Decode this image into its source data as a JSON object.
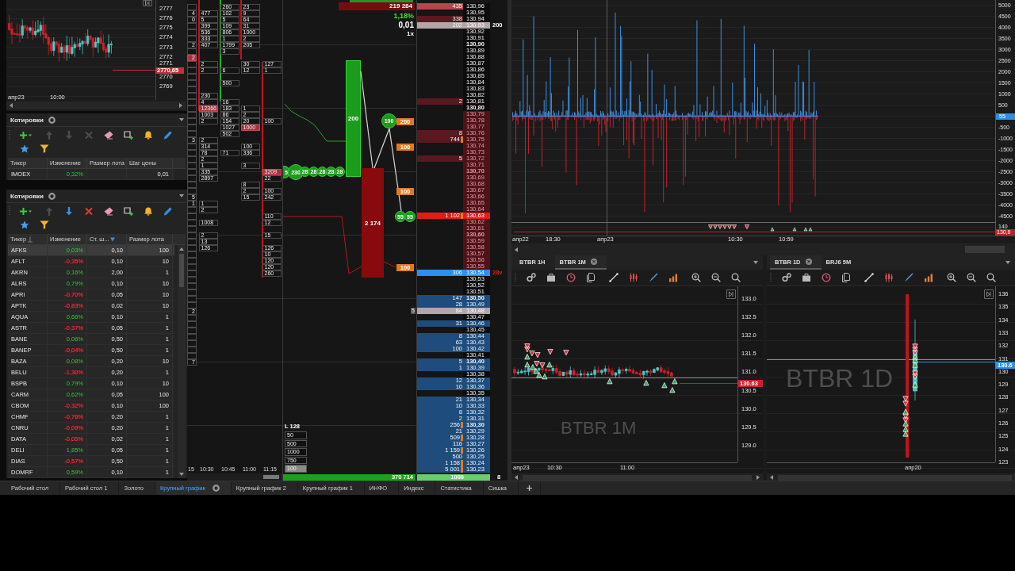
{
  "top_left_chart": {
    "price_labels": [
      "2777",
      "2776",
      "2775",
      "2774",
      "2773",
      "2772",
      "2771",
      "2770",
      "2769"
    ],
    "current_price": "2770,65",
    "time_labels": [
      "апр23",
      "10:00"
    ]
  },
  "quotes_panels": [
    {
      "title": "Котировки",
      "tools": [
        {
          "kind": "add",
          "disabled": false
        },
        {
          "kind": "up",
          "disabled": true
        },
        {
          "kind": "down",
          "disabled": true
        },
        {
          "kind": "delete",
          "disabled": true
        },
        {
          "kind": "eraser",
          "disabled": false
        },
        {
          "kind": "window",
          "disabled": false
        },
        {
          "kind": "bell",
          "disabled": false
        },
        {
          "kind": "pencil",
          "disabled": false
        },
        {
          "kind": "star",
          "disabled": false
        },
        {
          "kind": "filter",
          "disabled": false
        }
      ],
      "columns": [
        {
          "label": "Тикер",
          "kind": "ticker"
        },
        {
          "label": "Изменение",
          "kind": "change"
        },
        {
          "label": "Размер лота",
          "kind": "number"
        },
        {
          "label": "Шаг цены",
          "kind": "number"
        }
      ],
      "rows": [
        {
          "cells": [
            "IMOEX",
            "0,32%",
            null,
            "0,01"
          ],
          "negative": false,
          "selected": false
        }
      ]
    },
    {
      "title": "Котировки",
      "tools": [
        {
          "kind": "add",
          "disabled": false
        },
        {
          "kind": "up",
          "disabled": true
        },
        {
          "kind": "down",
          "disabled": false
        },
        {
          "kind": "delete",
          "disabled": false
        },
        {
          "kind": "eraser",
          "disabled": false
        },
        {
          "kind": "window",
          "disabled": false
        },
        {
          "kind": "bell",
          "disabled": false
        },
        {
          "kind": "pencil",
          "disabled": false
        },
        {
          "kind": "star",
          "disabled": false
        },
        {
          "kind": "filter",
          "disabled": false
        }
      ],
      "columns": [
        {
          "label": "Тикер",
          "kind": "ticker",
          "sorted": true,
          "filtered": false
        },
        {
          "label": "Изменение",
          "kind": "change",
          "sorted": false,
          "filtered": false
        },
        {
          "label": "Ст. ш...",
          "kind": "number",
          "sorted": false,
          "filtered": true
        },
        {
          "label": "Размер лота",
          "kind": "number",
          "sorted": false,
          "filtered": false
        }
      ],
      "rows": [
        {
          "cells": [
            "AFKS",
            "0,03%",
            "0,10",
            "100"
          ],
          "negative": false,
          "selected": true
        },
        {
          "cells": [
            "AFLT",
            "-0,35%",
            "0,10",
            "10"
          ],
          "negative": true,
          "selected": false
        },
        {
          "cells": [
            "AKRN",
            "0,16%",
            "2,00",
            "1"
          ],
          "negative": false,
          "selected": false
        },
        {
          "cells": [
            "ALRS",
            "0,79%",
            "0,10",
            "10"
          ],
          "negative": false,
          "selected": false
        },
        {
          "cells": [
            "APRI",
            "-0,70%",
            "0,05",
            "10"
          ],
          "negative": true,
          "selected": false
        },
        {
          "cells": [
            "APTK",
            "-0,83%",
            "0,02",
            "10"
          ],
          "negative": true,
          "selected": false
        },
        {
          "cells": [
            "AQUA",
            "0,66%",
            "0,10",
            "1"
          ],
          "negative": false,
          "selected": false
        },
        {
          "cells": [
            "ASTR",
            "-0,37%",
            "0,05",
            "1"
          ],
          "negative": true,
          "selected": false
        },
        {
          "cells": [
            "BANE",
            "0,06%",
            "0,50",
            "1"
          ],
          "negative": false,
          "selected": false
        },
        {
          "cells": [
            "BANEP",
            "-0,04%",
            "0,50",
            "1"
          ],
          "negative": true,
          "selected": false
        },
        {
          "cells": [
            "BAZA",
            "0,08%",
            "0,20",
            "10"
          ],
          "negative": false,
          "selected": false
        },
        {
          "cells": [
            "BELU",
            "-1,30%",
            "0,20",
            "1"
          ],
          "negative": true,
          "selected": false
        },
        {
          "cells": [
            "BSPB",
            "0,79%",
            "0,10",
            "10"
          ],
          "negative": false,
          "selected": false
        },
        {
          "cells": [
            "CARM",
            "0,62%",
            "0,05",
            "100"
          ],
          "negative": false,
          "selected": false
        },
        {
          "cells": [
            "CBOM",
            "-0,32%",
            "0,10",
            "100"
          ],
          "negative": true,
          "selected": false
        },
        {
          "cells": [
            "CHMF",
            "-0,76%",
            "0,20",
            "1"
          ],
          "negative": true,
          "selected": false
        },
        {
          "cells": [
            "CNRU",
            "-0,09%",
            "0,20",
            "1"
          ],
          "negative": true,
          "selected": false
        },
        {
          "cells": [
            "DATA",
            "-0,05%",
            "0,02",
            "1"
          ],
          "negative": true,
          "selected": false
        },
        {
          "cells": [
            "DELI",
            "1,85%",
            "0,05",
            "1"
          ],
          "negative": false,
          "selected": false
        },
        {
          "cells": [
            "DIAS",
            "-0,57%",
            "0,50",
            "1"
          ],
          "negative": true,
          "selected": false
        },
        {
          "cells": [
            "DOMRF",
            "0,59%",
            "0,10",
            "1"
          ],
          "negative": false,
          "selected": false
        }
      ]
    }
  ],
  "cluster": {
    "rows": [
      {
        "cells": [
          null,
          null,
          {
            "text": "260",
            "hot": false
          },
          {
            "text": "23",
            "hot": false
          },
          null
        ]
      },
      {
        "cells": [
          {
            "text": "4",
            "hot": false
          },
          {
            "text": "477",
            "hot": false
          },
          {
            "text": "102",
            "hot": false
          },
          {
            "text": "9",
            "hot": false
          },
          null
        ]
      },
      {
        "cells": [
          {
            "text": "0",
            "hot": false
          },
          {
            "text": "5",
            "hot": false
          },
          {
            "text": "5",
            "hot": false
          },
          {
            "text": "64",
            "hot": false
          },
          null
        ]
      },
      {
        "cells": [
          null,
          {
            "text": "399",
            "hot": false
          },
          {
            "text": "109",
            "hot": false
          },
          {
            "text": "31",
            "hot": false
          },
          null
        ]
      },
      {
        "cells": [
          null,
          {
            "text": "536",
            "hot": false
          },
          {
            "text": "806",
            "hot": false
          },
          {
            "text": "1000",
            "hot": false
          },
          null
        ]
      },
      {
        "cells": [
          null,
          {
            "text": "333",
            "hot": false
          },
          {
            "text": "1",
            "hot": false
          },
          {
            "text": "2",
            "hot": false
          },
          null
        ]
      },
      {
        "cells": [
          {
            "text": "2",
            "hot": false
          },
          {
            "text": "407",
            "hot": false
          },
          {
            "text": "1799",
            "hot": false
          },
          {
            "text": "205",
            "hot": false
          },
          null
        ]
      },
      {
        "cells": [
          null,
          null,
          {
            "text": "3",
            "hot": false
          },
          null,
          null
        ]
      },
      {
        "cells": [
          {
            "text": "2",
            "hot": true
          },
          null,
          null,
          null,
          null
        ]
      },
      {
        "cells": [
          null,
          {
            "text": "2",
            "hot": false
          },
          null,
          {
            "text": "30",
            "hot": false
          },
          {
            "text": "127",
            "hot": false
          }
        ]
      },
      {
        "cells": [
          null,
          {
            "text": "2",
            "hot": false
          },
          {
            "text": "6",
            "hot": false
          },
          {
            "text": "12",
            "hot": false
          },
          {
            "text": "1",
            "hot": false
          }
        ]
      },
      {
        "cells": [
          null,
          null,
          null,
          null,
          null
        ]
      },
      {
        "cells": [
          null,
          null,
          {
            "text": "500",
            "hot": false
          },
          null,
          null
        ]
      },
      {
        "cells": [
          null,
          null,
          null,
          null,
          null
        ]
      },
      {
        "cells": [
          null,
          {
            "text": "230",
            "hot": false
          },
          null,
          null,
          null
        ]
      },
      {
        "cells": [
          null,
          {
            "text": "4",
            "hot": false
          },
          {
            "text": "16",
            "hot": false
          },
          null,
          null
        ]
      },
      {
        "cells": [
          null,
          {
            "text": "12366",
            "hot": true
          },
          {
            "text": "183",
            "hot": false
          },
          {
            "text": "1",
            "hot": false
          },
          null
        ]
      },
      {
        "cells": [
          null,
          {
            "text": "1003",
            "hot": false
          },
          {
            "text": "86",
            "hot": false
          },
          {
            "text": "2",
            "hot": false
          },
          null
        ]
      },
      {
        "cells": [
          null,
          {
            "text": "2",
            "hot": false
          },
          {
            "text": "154",
            "hot": false
          },
          {
            "text": "20",
            "hot": false
          },
          {
            "text": "100",
            "hot": false
          }
        ]
      },
      {
        "cells": [
          null,
          null,
          {
            "text": "1027",
            "hot": false
          },
          {
            "text": "1000",
            "hot": true
          },
          null
        ]
      },
      {
        "cells": [
          null,
          null,
          {
            "text": "502",
            "hot": false
          },
          null,
          null
        ]
      },
      {
        "cells": [
          {
            "text": "3",
            "hot": false
          },
          {
            "text": "2",
            "hot": false
          },
          null,
          null,
          null
        ]
      },
      {
        "cells": [
          null,
          {
            "text": "314",
            "hot": false
          },
          null,
          {
            "text": "100",
            "hot": false
          },
          null
        ]
      },
      {
        "cells": [
          null,
          {
            "text": "78",
            "hot": false
          },
          {
            "text": "71",
            "hot": false
          },
          {
            "text": "336",
            "hot": false
          },
          null
        ]
      },
      {
        "cells": [
          null,
          {
            "text": "2",
            "hot": false
          },
          null,
          null,
          null
        ]
      },
      {
        "cells": [
          null,
          {
            "text": "1",
            "hot": false
          },
          null,
          {
            "text": "3",
            "hot": false
          },
          null
        ]
      },
      {
        "cells": [
          null,
          {
            "text": "335",
            "hot": false
          },
          null,
          null,
          {
            "text": "3209",
            "hot": true
          }
        ]
      },
      {
        "cells": [
          null,
          {
            "text": "2897",
            "hot": false
          },
          null,
          null,
          {
            "text": "22",
            "hot": false
          }
        ]
      },
      {
        "cells": [
          null,
          null,
          null,
          {
            "text": "8",
            "hot": false
          },
          null
        ]
      },
      {
        "cells": [
          null,
          null,
          null,
          {
            "text": "2",
            "hot": false
          },
          {
            "text": "100",
            "hot": false
          }
        ]
      },
      {
        "cells": [
          {
            "text": "5",
            "hot": false
          },
          null,
          null,
          {
            "text": "15",
            "hot": false
          },
          {
            "text": "242",
            "hot": false
          }
        ]
      },
      {
        "cells": [
          {
            "text": "1",
            "hot": false
          },
          {
            "text": "1",
            "hot": false
          },
          null,
          null,
          null
        ]
      },
      {
        "cells": [
          null,
          {
            "text": "2",
            "hot": false
          },
          null,
          null,
          null
        ]
      },
      {
        "cells": [
          null,
          null,
          null,
          null,
          {
            "text": "110",
            "hot": false
          }
        ]
      },
      {
        "cells": [
          null,
          {
            "text": "1008",
            "hot": false
          },
          null,
          null,
          {
            "text": "12",
            "hot": false
          }
        ]
      },
      {
        "cells": [
          null,
          null,
          null,
          null,
          null
        ]
      },
      {
        "cells": [
          null,
          {
            "text": "2",
            "hot": false
          },
          null,
          null,
          {
            "text": "15",
            "hot": false
          }
        ]
      },
      {
        "cells": [
          null,
          {
            "text": "13",
            "hot": false
          },
          null,
          null,
          null
        ]
      },
      {
        "cells": [
          null,
          {
            "text": "126",
            "hot": false
          },
          null,
          null,
          {
            "text": "126",
            "hot": false
          }
        ]
      },
      {
        "cells": [
          null,
          null,
          null,
          null,
          {
            "text": "10",
            "hot": false
          }
        ]
      },
      {
        "cells": [
          null,
          null,
          null,
          null,
          {
            "text": "120",
            "hot": false
          }
        ]
      },
      {
        "cells": [
          null,
          null,
          null,
          null,
          {
            "text": "120",
            "hot": false
          }
        ]
      },
      {
        "cells": [
          null,
          null,
          null,
          null,
          {
            "text": "260",
            "hot": false
          }
        ]
      },
      {
        "cells": [
          null,
          null,
          null,
          null,
          null
        ]
      },
      {
        "cells": [
          null,
          null,
          null,
          null,
          null
        ]
      },
      {
        "cells": [
          null,
          null,
          null,
          null,
          null
        ]
      },
      {
        "cells": [
          null,
          null,
          null,
          null,
          null
        ]
      },
      {
        "cells": [
          null,
          null,
          null,
          null,
          null
        ]
      },
      {
        "cells": [
          {
            "text": "2",
            "hot": false
          },
          null,
          null,
          null,
          null
        ]
      },
      {
        "cells": [
          null,
          null,
          null,
          null,
          null
        ]
      },
      {
        "cells": [
          null,
          null,
          null,
          null,
          null
        ]
      },
      {
        "cells": [
          null,
          null,
          null,
          null,
          null
        ]
      },
      {
        "cells": [
          null,
          null,
          null,
          null,
          null
        ]
      },
      {
        "cells": [
          null,
          null,
          null,
          null,
          null
        ]
      },
      {
        "cells": [
          null,
          null,
          null,
          null,
          null
        ]
      },
      {
        "cells": [
          null,
          null,
          null,
          null,
          null
        ]
      },
      {
        "cells": [
          {
            "text": "7",
            "hot": false
          },
          null,
          null,
          null,
          null
        ]
      }
    ],
    "time_labels": [
      "15",
      "10:30",
      "10:45",
      "11:00",
      "11:15"
    ]
  },
  "footprint": {
    "header_volume": "219 284",
    "change": "1,18%",
    "price_step": "0,01",
    "scale": "1x",
    "bars": [
      {
        "kind": "buy",
        "label": "200"
      },
      {
        "kind": "sell",
        "label": "2 174"
      }
    ],
    "bubbles": [
      {
        "label": "5"
      },
      {
        "label": "230"
      },
      {
        "label": "28"
      },
      {
        "label": "28"
      },
      {
        "label": "28"
      },
      {
        "label": "28"
      },
      {
        "label": "28"
      },
      {
        "label": "100"
      },
      {
        "label": "55"
      },
      {
        "label": "55"
      }
    ],
    "orders": [
      {
        "label": "200"
      },
      {
        "label": "100"
      },
      {
        "label": "100"
      },
      {
        "label": "100"
      }
    ],
    "lot_title": "L 128",
    "lot_presets": [
      {
        "label": "50",
        "selected": false
      },
      {
        "label": "500",
        "selected": false
      },
      {
        "label": "1000",
        "selected": false
      },
      {
        "label": "750",
        "selected": false
      },
      {
        "label": "100",
        "selected": true
      }
    ],
    "total_volume": "370 714"
  },
  "order_book": {
    "rows": [
      {
        "price": "130,96",
        "volume": "435",
        "kind": "ask_strong",
        "bold": false,
        "order": false
      },
      {
        "price": "130,95",
        "kind": "plain",
        "bold": false,
        "order": false
      },
      {
        "price": "130,94",
        "volume": "338",
        "kind": "ask",
        "bold": false,
        "order": false
      },
      {
        "price": "130,93",
        "volume": "202",
        "kind": "cursor",
        "bold": false,
        "order": false,
        "note": {
          "text": "200",
          "color": "#ffffff"
        }
      },
      {
        "price": "130,92",
        "kind": "plain",
        "bold": false,
        "order": false
      },
      {
        "price": "130,91",
        "kind": "plain",
        "bold": false,
        "order": false
      },
      {
        "price": "130,90",
        "kind": "plain",
        "bold": true,
        "order": false
      },
      {
        "price": "130,89",
        "kind": "plain",
        "bold": false,
        "order": false
      },
      {
        "price": "130,88",
        "kind": "plain",
        "bold": false,
        "order": false
      },
      {
        "price": "130,87",
        "kind": "plain",
        "bold": false,
        "order": false
      },
      {
        "price": "130,86",
        "kind": "plain",
        "bold": false,
        "order": false
      },
      {
        "price": "130,85",
        "kind": "plain",
        "bold": false,
        "order": false
      },
      {
        "price": "130,84",
        "kind": "plain",
        "bold": false,
        "order": false
      },
      {
        "price": "130,83",
        "kind": "plain",
        "bold": false,
        "order": false
      },
      {
        "price": "130,82",
        "kind": "plain",
        "bold": false,
        "order": false
      },
      {
        "price": "130,81",
        "volume": "2",
        "kind": "ask",
        "bold": false,
        "order": false
      },
      {
        "price": "130,80",
        "kind": "plain",
        "bold": true,
        "order": false
      },
      {
        "price": "130,79",
        "kind": "spread",
        "bold": false,
        "order": false
      },
      {
        "price": "130,78",
        "kind": "spread",
        "bold": false,
        "order": false
      },
      {
        "price": "130,77",
        "kind": "spread",
        "bold": false,
        "order": false
      },
      {
        "price": "130,76",
        "volume": "8",
        "kind": "spread",
        "bold": false,
        "order": false
      },
      {
        "price": "130,75",
        "volume": "744",
        "kind": "spread",
        "bold": false,
        "order": true
      },
      {
        "price": "130,74",
        "kind": "spread",
        "bold": false,
        "order": false
      },
      {
        "price": "130,73",
        "kind": "spread",
        "bold": false,
        "order": false
      },
      {
        "price": "130,72",
        "volume": "5",
        "kind": "spread",
        "bold": false,
        "order": false
      },
      {
        "price": "130,71",
        "kind": "spread",
        "bold": false,
        "order": false
      },
      {
        "price": "130,70",
        "kind": "spread",
        "bold": true,
        "order": false
      },
      {
        "price": "130,69",
        "kind": "spread",
        "bold": false,
        "order": false
      },
      {
        "price": "130,68",
        "kind": "spread",
        "bold": false,
        "order": false
      },
      {
        "price": "130,67",
        "kind": "spread",
        "bold": false,
        "order": false
      },
      {
        "price": "130,66",
        "kind": "spread",
        "bold": false,
        "order": false
      },
      {
        "price": "130,65",
        "kind": "spread",
        "bold": false,
        "order": false
      },
      {
        "price": "130,64",
        "kind": "spread",
        "bold": false,
        "order": false
      },
      {
        "price": "130,63",
        "volume": "1 102",
        "kind": "best_ask",
        "bold": false,
        "order": true
      },
      {
        "price": "130,62",
        "kind": "spread",
        "bold": false,
        "order": false
      },
      {
        "price": "130,61",
        "kind": "spread",
        "bold": false,
        "order": false
      },
      {
        "price": "130,60",
        "kind": "spread",
        "bold": true,
        "order": false
      },
      {
        "price": "130,59",
        "kind": "spread",
        "bold": false,
        "order": false
      },
      {
        "price": "130,58",
        "kind": "spread",
        "bold": false,
        "order": false
      },
      {
        "price": "130,57",
        "kind": "spread",
        "bold": false,
        "order": false
      },
      {
        "price": "130,56",
        "kind": "spread",
        "bold": false,
        "order": false
      },
      {
        "price": "130,55",
        "kind": "spread",
        "bold": false,
        "order": false
      },
      {
        "price": "130,54",
        "volume": "306",
        "kind": "best_bid",
        "bold": false,
        "order": false,
        "note": {
          "text": "28v",
          "color": "#e02020"
        }
      },
      {
        "price": "130,53",
        "kind": "plain",
        "bold": false,
        "order": false
      },
      {
        "price": "130,52",
        "kind": "plain",
        "bold": false,
        "order": false
      },
      {
        "price": "130,51",
        "kind": "plain",
        "bold": false,
        "order": false
      },
      {
        "price": "130,50",
        "volume": "147",
        "kind": "bid",
        "bold": true,
        "order": false
      },
      {
        "price": "130,49",
        "volume": "28",
        "kind": "bid",
        "bold": false,
        "order": false
      },
      {
        "price": "130,48",
        "volume": "84",
        "kind": "cursor",
        "bold": false,
        "order": false,
        "marker": "5"
      },
      {
        "price": "130,47",
        "kind": "plain",
        "bold": false,
        "order": false
      },
      {
        "price": "130,46",
        "volume": "31",
        "kind": "bid",
        "bold": false,
        "order": false
      },
      {
        "price": "130,45",
        "kind": "plain",
        "bold": false,
        "order": false
      },
      {
        "price": "130,44",
        "volume": "8",
        "kind": "bid",
        "bold": false,
        "order": false
      },
      {
        "price": "130,43",
        "volume": "63",
        "kind": "bid",
        "bold": false,
        "order": false
      },
      {
        "price": "130,42",
        "volume": "100",
        "kind": "bid",
        "bold": false,
        "order": false
      },
      {
        "price": "130,41",
        "kind": "plain",
        "bold": false,
        "order": false
      },
      {
        "price": "130,40",
        "volume": "5",
        "kind": "bid",
        "bold": true,
        "order": false
      },
      {
        "price": "130,39",
        "volume": "1",
        "kind": "bid",
        "bold": false,
        "order": false
      },
      {
        "price": "130,38",
        "kind": "plain",
        "bold": false,
        "order": false
      },
      {
        "price": "130,37",
        "volume": "12",
        "kind": "bid",
        "bold": false,
        "order": false
      },
      {
        "price": "130,36",
        "volume": "10",
        "kind": "bid",
        "bold": false,
        "order": false
      },
      {
        "price": "130,35",
        "kind": "plain",
        "bold": false,
        "order": false
      },
      {
        "price": "130,34",
        "volume": "21",
        "kind": "bid",
        "bold": false,
        "order": false
      },
      {
        "price": "130,33",
        "volume": "10",
        "kind": "bid",
        "bold": false,
        "order": false
      },
      {
        "price": "130,32",
        "volume": "8",
        "kind": "bid",
        "bold": false,
        "order": false
      },
      {
        "price": "130,31",
        "volume": "2",
        "kind": "bid",
        "bold": false,
        "order": false
      },
      {
        "price": "130,30",
        "volume": "256",
        "kind": "bid",
        "bold": true,
        "order": true
      },
      {
        "price": "130,29",
        "volume": "21",
        "kind": "bid",
        "bold": false,
        "order": false
      },
      {
        "price": "130,28",
        "volume": "509",
        "kind": "bid",
        "bold": false,
        "order": true
      },
      {
        "price": "130,27",
        "volume": "116",
        "kind": "bid",
        "bold": false,
        "order": false
      },
      {
        "price": "130,26",
        "volume": "1 159",
        "kind": "bid",
        "bold": false,
        "order": true
      },
      {
        "price": "130,25",
        "volume": "500",
        "kind": "bid",
        "bold": false,
        "order": false
      },
      {
        "price": "130,24",
        "volume": "1 158",
        "kind": "bid",
        "bold": false,
        "order": true
      },
      {
        "price": "130,23",
        "volume": "5 001",
        "kind": "bid",
        "bold": false,
        "order": true
      }
    ],
    "footer_volume": "1000",
    "footer_count": "8"
  },
  "delta_chart": {
    "y_labels": [
      "5000",
      "4500",
      "4000",
      "3500",
      "3000",
      "2500",
      "2000",
      "1500",
      "1000",
      "500",
      "-500",
      "-1000",
      "-1500",
      "-2000",
      "-2500",
      "-3000",
      "-3500",
      "-4000",
      "-4500"
    ],
    "current_value": "55",
    "pane_label": "140",
    "pane_price": "130,6",
    "time_labels": [
      "апр22",
      "18:30",
      "апр23",
      "10:30",
      "10:59"
    ]
  },
  "charts": [
    {
      "tabs": [
        {
          "label": "BTBR 1H",
          "selected": false
        },
        {
          "label": "BTBR 1M",
          "selected": true
        }
      ],
      "y_labels": [
        "133.0",
        "132.5",
        "132.0",
        "131.5",
        "131.0",
        "130.5",
        "130.0",
        "129.5",
        "129.0"
      ],
      "current_price": {
        "text": "130.63",
        "color": "#c8202c"
      },
      "time_labels": [
        "апр23",
        "10:30",
        "11:00"
      ],
      "watermark": "BTBR 1M"
    },
    {
      "tabs": [
        {
          "label": "BTBR 1D",
          "selected": true
        },
        {
          "label": "BRJ6 5M",
          "selected": false
        }
      ],
      "y_labels": [
        "136",
        "135",
        "134",
        "133",
        "132",
        "131",
        "130",
        "129",
        "128",
        "127",
        "126",
        "125",
        "124",
        "123"
      ],
      "current_price": {
        "text": "130.6",
        "color": "#2d8ee8"
      },
      "time_labels": [
        "апр20"
      ],
      "watermark": "BTBR 1D"
    }
  ],
  "workspace_tabs": [
    {
      "label": "Рабочий стол",
      "selected": false
    },
    {
      "label": "Рабочий стол 1",
      "selected": false
    },
    {
      "label": "Золото",
      "selected": false
    },
    {
      "label": "Крупный график",
      "selected": true
    },
    {
      "label": "Крупный график 2",
      "selected": false
    },
    {
      "label": "Крупный график 1",
      "selected": false
    },
    {
      "label": "ИНФО",
      "selected": false
    },
    {
      "label": "Индекс",
      "selected": false
    },
    {
      "label": "Статистика",
      "selected": false
    },
    {
      "label": "Сишка",
      "selected": false
    }
  ]
}
